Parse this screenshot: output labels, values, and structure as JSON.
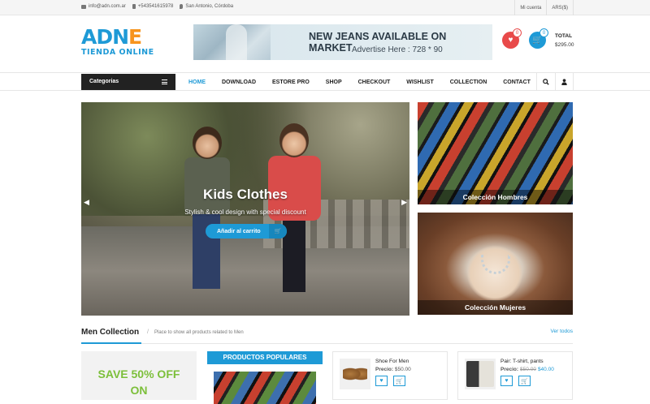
{
  "topbar": {
    "email": "info@adn.com.ar",
    "phone": "+543541615978",
    "location": "San Antonio, Córdoba",
    "account": "Mi cuenta",
    "currency": "ARS($)"
  },
  "logo": {
    "main": "ADN",
    "sub": "TIENDA ONLINE"
  },
  "banner": {
    "title": "NEW JEANS AVAILABLE ON MARKET",
    "sub": "Advertise Here : 728 * 90"
  },
  "cart": {
    "wish_count": "0",
    "cart_count": "0",
    "total_label": "TOTAL",
    "total_value": "$295.00"
  },
  "nav": {
    "categories": "Categorias",
    "items": [
      "HOME",
      "DOWNLOAD",
      "ESTORE PRO",
      "SHOP",
      "CHECKOUT",
      "WISHLIST",
      "COLLECTION",
      "CONTACT"
    ]
  },
  "slider": {
    "title": "Kids Clothes",
    "subtitle": "Stylish & cool design with special discount",
    "button": "Añadir al carrito"
  },
  "side": {
    "men": "Colección Hombres",
    "women": "Colección Mujeres"
  },
  "section": {
    "title": "Men Collection",
    "sep": "/",
    "desc": "Place to show all products related to Men",
    "view_all": "Ver todos"
  },
  "promo": {
    "line1": "SAVE 50% OFF",
    "line2": "ON"
  },
  "popular": {
    "title": "PRODUCTOS POPULARES"
  },
  "products": [
    {
      "name": "Shoe For Men",
      "price_label": "Precio:",
      "price": "$50.00",
      "old_price": "",
      "new_price": ""
    },
    {
      "name": "Pair: T-shirt, pants",
      "price_label": "Precio:",
      "price": "",
      "old_price": "$50.00",
      "new_price": "$40.00"
    }
  ],
  "colors": {
    "accent": "#1e9ad6",
    "heart": "#e84a4a",
    "promo": "#7cbf3a",
    "dark": "#222222"
  }
}
